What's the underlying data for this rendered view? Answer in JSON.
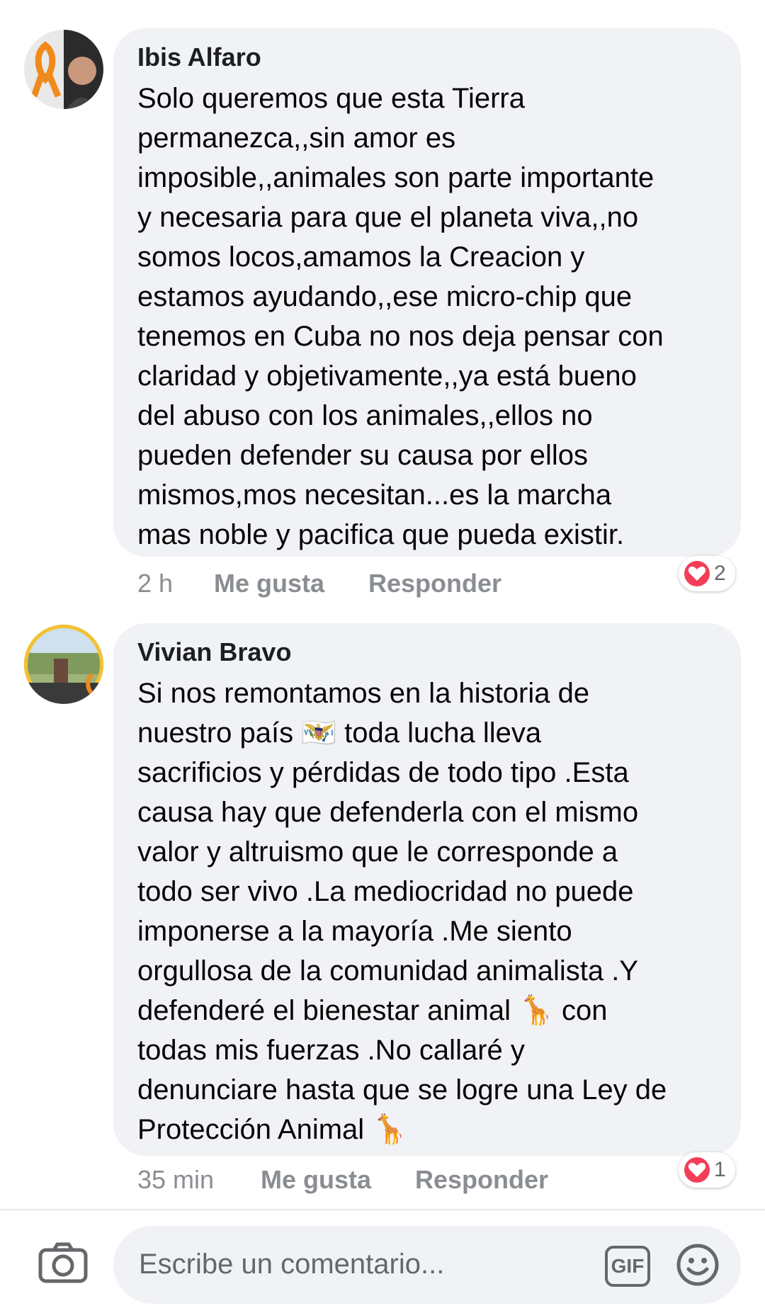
{
  "comments": [
    {
      "author": "Ibis Alfaro",
      "lines": [
        "Solo queremos que esta Tierra",
        "permanezca,,sin amor es",
        "imposible,,animales son parte importante",
        "y necesaria para que el planeta viva,,no",
        "somos locos,amamos la Creacion y",
        "estamos ayudando,,ese micro-chip que",
        "tenemos en Cuba no nos deja pensar con",
        "claridad y objetivamente,,ya está bueno",
        "del abuso con los animales,,ellos no",
        "pueden defender su causa por ellos",
        "mismos,mos necesitan...es la marcha",
        "mas noble y pacifica que pueda existir."
      ],
      "time": "2 h",
      "like_label": "Me gusta",
      "reply_label": "Responder",
      "reaction_count": "2",
      "reaction_icon": "heart-reaction-icon"
    },
    {
      "author": "Vivian Bravo",
      "lines": [
        "Si nos remontamos en la historia de",
        "nuestro país 🇻🇮 toda lucha lleva",
        "sacrificios y pérdidas de todo tipo .Esta",
        "causa hay que defenderla con el mismo",
        "valor y altruismo que le corresponde a",
        "todo ser vivo .La mediocridad no puede",
        "imponerse a la mayoría .Me siento",
        "orgullosa de la comunidad animalista .Y",
        "defenderé el bienestar animal 🦒 con",
        "todas mis fuerzas .No callaré y",
        "denunciare hasta que se logre una Ley de",
        "Protección Animal 🦒"
      ],
      "time": "35 min",
      "like_label": "Me gusta",
      "reply_label": "Responder",
      "reaction_count": "1",
      "reaction_icon": "heart-reaction-icon"
    }
  ],
  "composer": {
    "placeholder": "Escribe un comentario...",
    "gif_label": "GIF",
    "icons": [
      "camera-icon",
      "gif-icon",
      "emoji-icon"
    ]
  },
  "colors": {
    "bubble": "#f0f2f5",
    "meta_text": "#8a8d91",
    "heart": "#f33e58"
  }
}
